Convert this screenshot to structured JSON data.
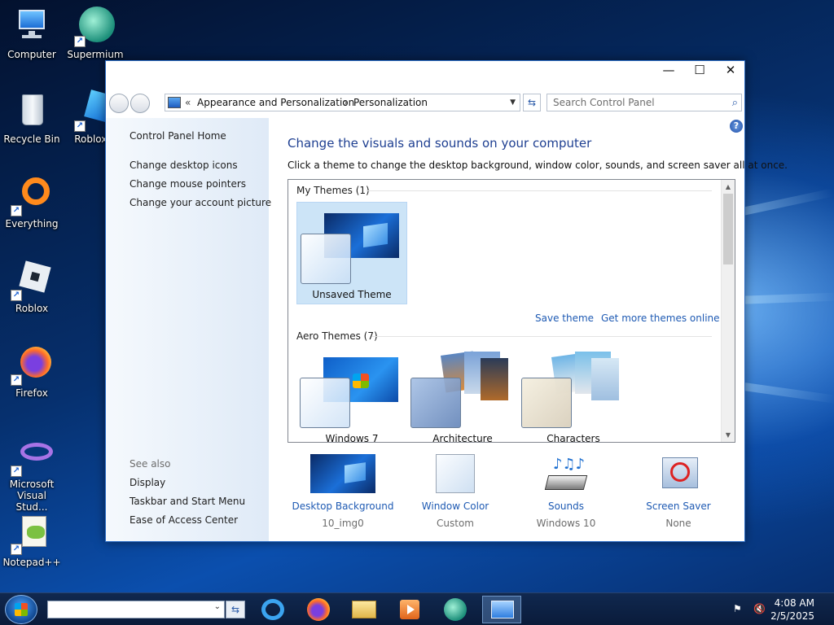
{
  "desktop": {
    "icons": [
      {
        "label": "Computer"
      },
      {
        "label": "Supermium"
      },
      {
        "label": "Recycle Bin"
      },
      {
        "label": "Roblox S"
      },
      {
        "label": "Everything"
      },
      {
        "label": "Roblox"
      },
      {
        "label": "Firefox"
      },
      {
        "label": "Microsoft Visual Stud..."
      },
      {
        "label": "Notepad++"
      }
    ]
  },
  "window": {
    "controls": {
      "minimize": "—",
      "maximize": "☐",
      "close": "✕"
    },
    "address": {
      "prefix": "«",
      "crumbs": [
        "Appearance and Personalization",
        "Personalization"
      ],
      "separator": "›"
    },
    "search_placeholder": "Search Control Panel",
    "left_pane": {
      "home": "Control Panel Home",
      "links": [
        "Change desktop icons",
        "Change mouse pointers",
        "Change your account picture"
      ],
      "see_also_heading": "See also",
      "see_also": [
        "Display",
        "Taskbar and Start Menu",
        "Ease of Access Center"
      ]
    },
    "main": {
      "title": "Change the visuals and sounds on your computer",
      "subtitle": "Click a theme to change the desktop background, window color, sounds, and screen saver all at once.",
      "help": "?",
      "my_themes_heading": "My Themes (1)",
      "my_themes": [
        {
          "name": "Unsaved Theme",
          "selected": true
        }
      ],
      "save_theme": "Save theme",
      "get_more": "Get more themes online",
      "aero_heading": "Aero Themes (7)",
      "aero_themes": [
        {
          "name": "Windows 7"
        },
        {
          "name": "Architecture"
        },
        {
          "name": "Characters"
        }
      ]
    },
    "bottom": [
      {
        "name": "Desktop Background",
        "value": "10_img0"
      },
      {
        "name": "Window Color",
        "value": "Custom"
      },
      {
        "name": "Sounds",
        "value": "Windows 10"
      },
      {
        "name": "Screen Saver",
        "value": "None"
      }
    ]
  },
  "taskbar": {
    "search_value": "",
    "clock": {
      "time": "4:08 AM",
      "date": "2/5/2025"
    }
  },
  "colors": {
    "accent": "#1e5ab3",
    "title_blue": "#1e3f91",
    "selection": "#cce4f7"
  }
}
